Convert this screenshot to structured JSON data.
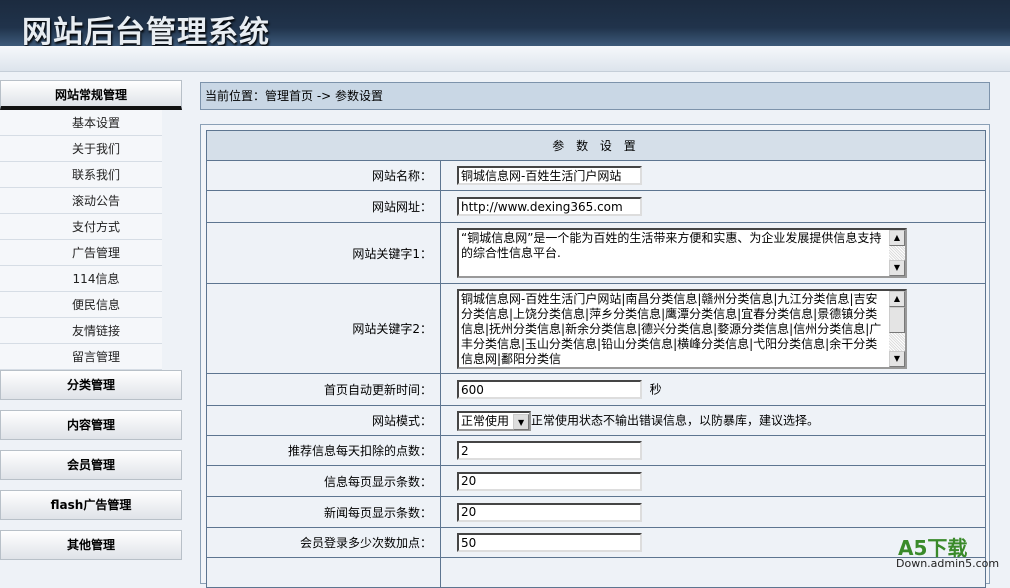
{
  "header": {
    "title": "网站后台管理系统"
  },
  "sidebar": {
    "groups": [
      {
        "label": "网站常规管理",
        "items": [
          "基本设置",
          "关于我们",
          "联系我们",
          "滚动公告",
          "支付方式",
          "广告管理",
          "114信息",
          "便民信息",
          "友情链接",
          "留言管理"
        ]
      },
      {
        "label": "分类管理"
      },
      {
        "label": "内容管理"
      },
      {
        "label": "会员管理"
      },
      {
        "label": "flash广告管理"
      },
      {
        "label": "其他管理"
      }
    ]
  },
  "breadcrumb": "当前位置：管理首页 -> 参数设置",
  "form": {
    "title": "参 数 设 置",
    "site_name": {
      "label": "网站名称：",
      "value": "铜城信息网-百姓生活门户网站"
    },
    "site_url": {
      "label": "网站网址：",
      "value": "http://www.dexing365.com"
    },
    "keyword1": {
      "label": "网站关键字1：",
      "value": "“铜城信息网”是一个能为百姓的生活带来方便和实惠、为企业发展提供信息支持的综合性信息平台."
    },
    "keyword2": {
      "label": "网站关键字2：",
      "value": "铜城信息网-百姓生活门户网站|南昌分类信息|赣州分类信息|九江分类信息|吉安分类信息|上饶分类信息|萍乡分类信息|鹰潭分类信息|宜春分类信息|景德镇分类信息|抚州分类信息|新余分类信息|德兴分类信息|婺源分类信息|信州分类信息|广丰分类信息|玉山分类信息|铅山分类信息|横峰分类信息|弋阳分类信息|余干分类信息网|鄱阳分类信"
    },
    "refresh": {
      "label": "首页自动更新时间：",
      "value": "600",
      "unit": "秒"
    },
    "mode": {
      "label": "网站模式：",
      "value": "正常使用",
      "hint": "正常使用状态不输出错误信息，以防暴库，建议选择。"
    },
    "points": {
      "label": "推荐信息每天扣除的点数：",
      "value": "2"
    },
    "info_per_page": {
      "label": "信息每页显示条数：",
      "value": "20"
    },
    "news_per_page": {
      "label": "新闻每页显示条数：",
      "value": "20"
    },
    "login_points": {
      "label": "会员登录多少次数加点：",
      "value": "50"
    }
  },
  "watermark": {
    "logo": "A5下载",
    "url": "Down.admin5.com"
  }
}
